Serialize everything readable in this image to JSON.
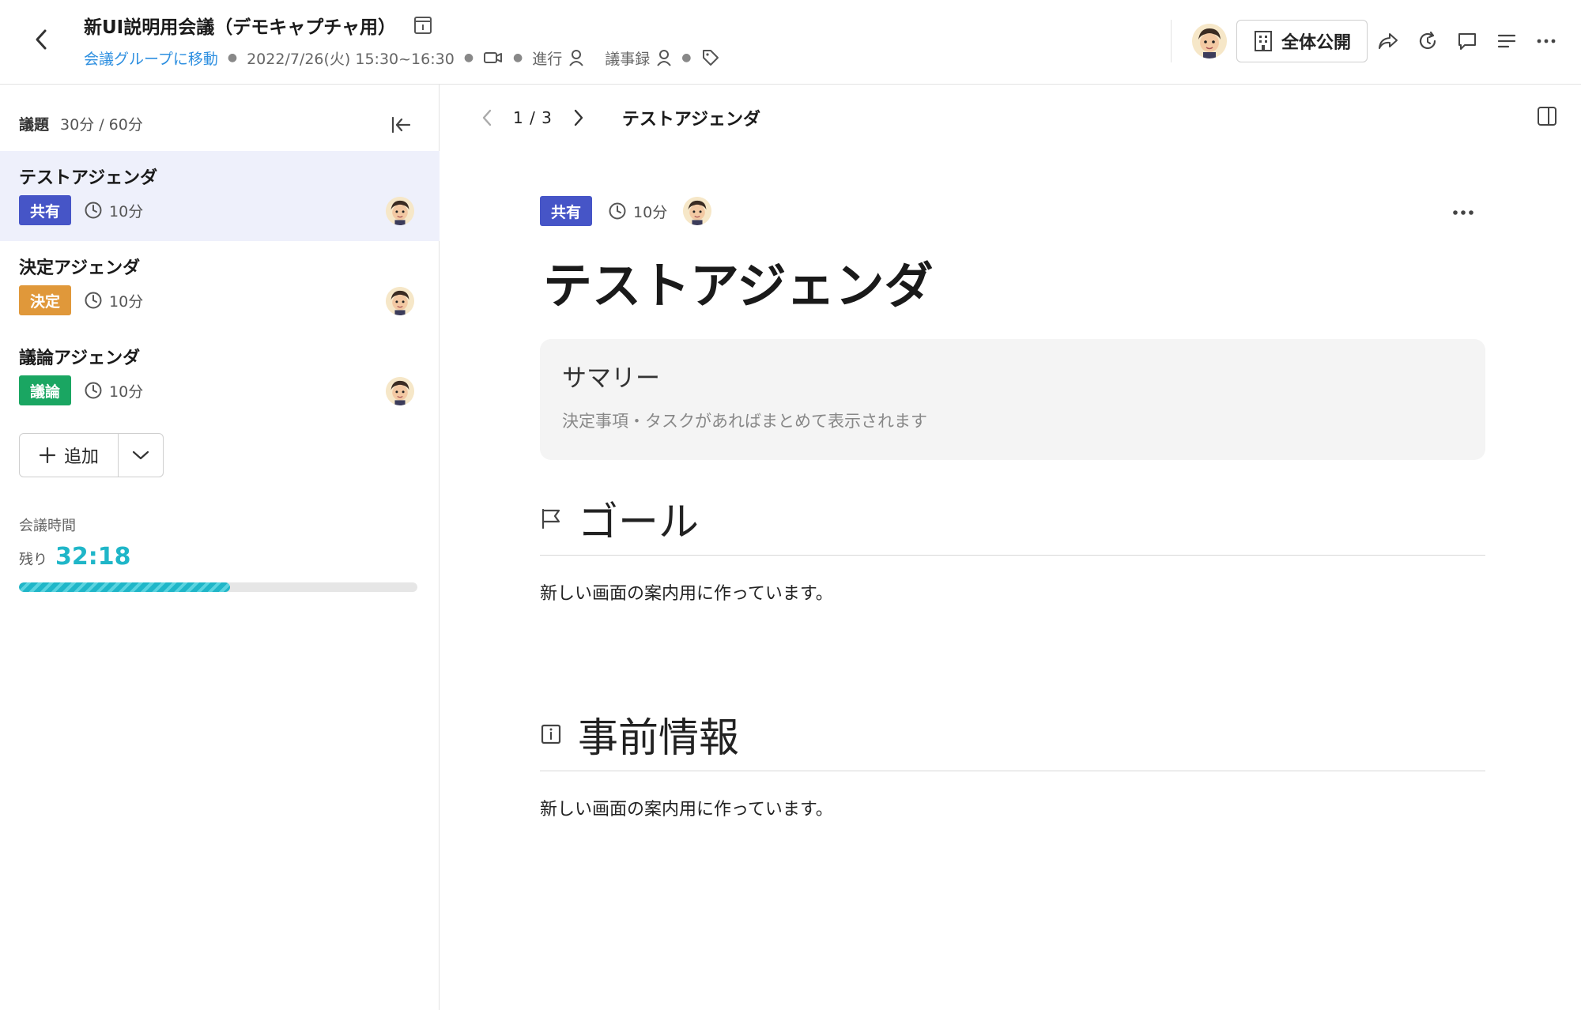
{
  "header": {
    "title": "新UI説明用会議（デモキャプチャ用）",
    "group_link": "会議グループに移動",
    "datetime": "2022/7/26(火) 15:30~16:30",
    "progress_role": "進行",
    "minutes_role": "議事録",
    "public_label": "全体公開"
  },
  "sidebar": {
    "agenda_label": "議題",
    "duration": "30分 / 60分",
    "items": [
      {
        "title": "テストアジェンダ",
        "badge": "共有",
        "badge_color": "#4655c7",
        "time": "10分"
      },
      {
        "title": "決定アジェンダ",
        "badge": "決定",
        "badge_color": "#e0983a",
        "time": "10分"
      },
      {
        "title": "議論アジェンダ",
        "badge": "議論",
        "badge_color": "#1aa662",
        "time": "10分"
      }
    ],
    "add_label": "追加",
    "meeting_time_label": "会議時間",
    "remaining_label": "残り",
    "remaining_time": "32:18",
    "time_progress_percent": 53
  },
  "main": {
    "page_count": "1 / 3",
    "page_title": "テストアジェンダ",
    "badge": "共有",
    "badge_color": "#4655c7",
    "time": "10分",
    "title": "テストアジェンダ",
    "summary_heading": "サマリー",
    "summary_placeholder": "決定事項・タスクがあればまとめて表示されます",
    "sections": [
      {
        "heading": "ゴール",
        "body": "新しい画面の案内用に作っています。"
      },
      {
        "heading": "事前情報",
        "body": "新しい画面の案内用に作っています。"
      }
    ]
  },
  "colors": {
    "accent": "#2d8fe0",
    "progress": "#1fb6c8",
    "active_item_bg": "#eef0fb"
  }
}
